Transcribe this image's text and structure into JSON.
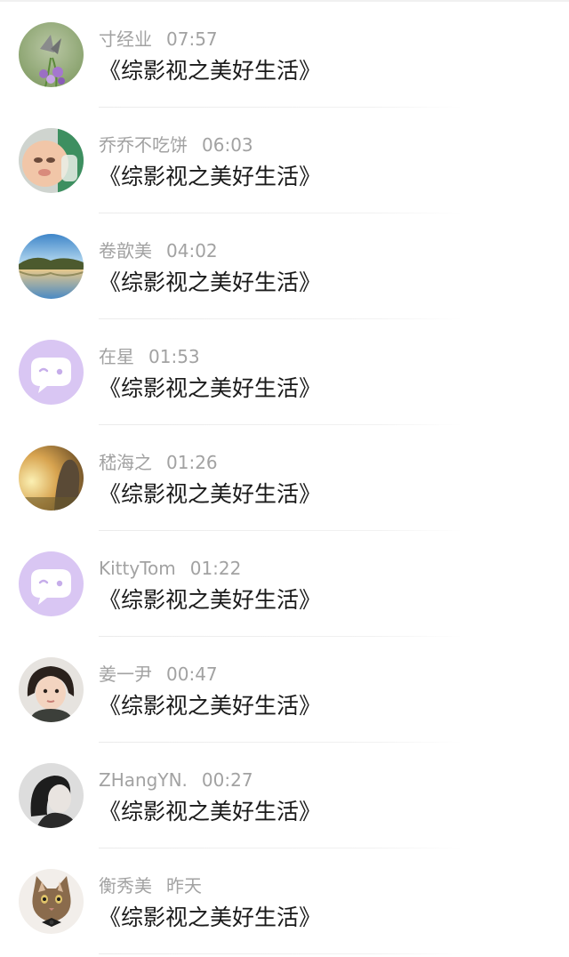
{
  "messages": [
    {
      "name": "寸经业",
      "time": "07:57",
      "text": "《综影视之美好生活》",
      "avatar": "butterfly-flower-photo"
    },
    {
      "name": "乔乔不吃饼",
      "time": "06:03",
      "text": "《综影视之美好生活》",
      "avatar": "baby-photo"
    },
    {
      "name": "卷歆美",
      "time": "04:02",
      "text": "《综影视之美好生活》",
      "avatar": "lake-landscape-photo"
    },
    {
      "name": "在星",
      "time": "01:53",
      "text": "《综影视之美好生活》",
      "avatar": "default-chat-bubble"
    },
    {
      "name": "嵇海之",
      "time": "01:26",
      "text": "《综影视之美好生活》",
      "avatar": "sunset-person-photo"
    },
    {
      "name": "KittyTom",
      "time": "01:22",
      "text": "《综影视之美好生活》",
      "avatar": "default-chat-bubble"
    },
    {
      "name": "姜一尹",
      "time": "00:47",
      "text": "《综影视之美好生活》",
      "avatar": "child-portrait-photo"
    },
    {
      "name": "ZHangYN.",
      "time": "00:27",
      "text": "《综影视之美好生活》",
      "avatar": "woman-portrait-photo"
    },
    {
      "name": "衡秀美",
      "time": "昨天",
      "text": "《综影视之美好生活》",
      "avatar": "kitten-photo"
    }
  ],
  "colors": {
    "meta_text": "#a2a2a2",
    "message_text": "#1a1a1a",
    "default_avatar_bg": "#d9c6f3",
    "divider": "#ebebeb"
  }
}
